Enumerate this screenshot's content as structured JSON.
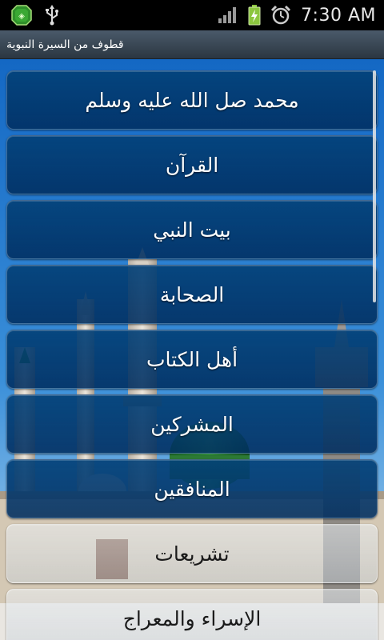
{
  "status_bar": {
    "time": "7:30 AM",
    "icons": [
      "app-notification-icon",
      "usb-icon",
      "signal-icon",
      "battery-charging-icon",
      "alarm-icon"
    ]
  },
  "title_bar": {
    "title": "قطوف من السيرة النبوية"
  },
  "menu": {
    "items": [
      {
        "label": "محمد صل الله عليه وسلم"
      },
      {
        "label": "القرآن"
      },
      {
        "label": "بيت النبي"
      },
      {
        "label": "الصحابة"
      },
      {
        "label": "أهل الكتاب"
      },
      {
        "label": "المشركين"
      },
      {
        "label": "المنافقين"
      },
      {
        "label": "تشريعات"
      },
      {
        "label": "الإسراء والمعراج"
      }
    ]
  },
  "colors": {
    "status_bar_bg": "#000000",
    "title_bar_bg": "#34414e",
    "menu_item_bg": "#03417a",
    "menu_text": "#ffffff"
  }
}
